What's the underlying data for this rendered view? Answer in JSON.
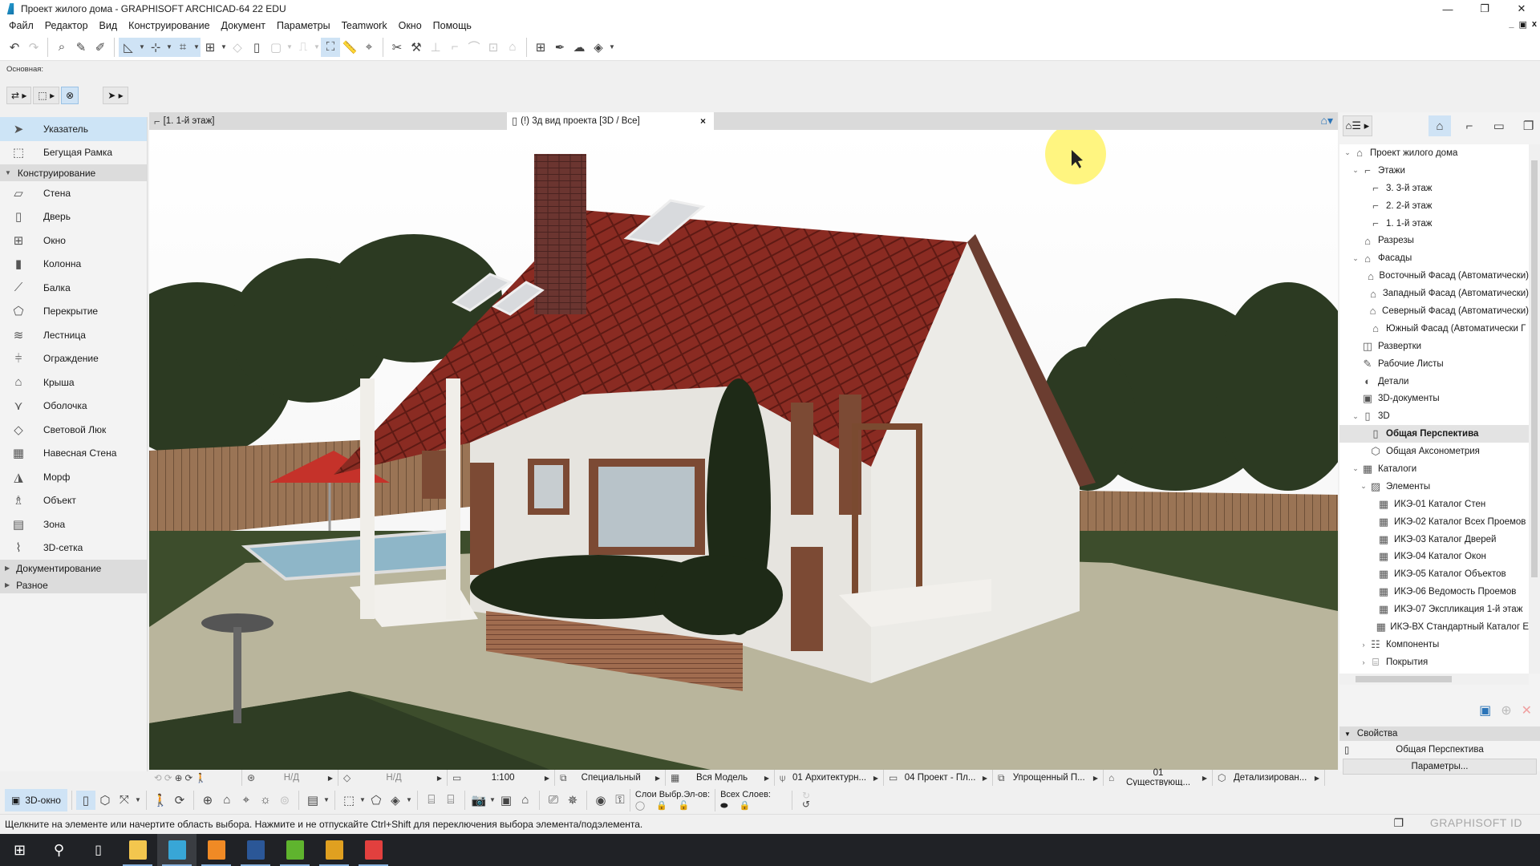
{
  "window": {
    "title": "Проект жилого дома - GRAPHISOFT ARCHICAD-64 22 EDU",
    "controls": [
      "—",
      "❐",
      "✕"
    ],
    "mdi_controls": [
      "_",
      "▣",
      "x"
    ]
  },
  "menu": [
    "Файл",
    "Редактор",
    "Вид",
    "Конструирование",
    "Документ",
    "Параметры",
    "Teamwork",
    "Окно",
    "Помощь"
  ],
  "infobox": {
    "label": "Основная:"
  },
  "toolbox": {
    "top_items": [
      {
        "label": "Указатель",
        "icon": "arrow-pointer-icon",
        "glyph": "➤",
        "selected": true
      },
      {
        "label": "Бегущая Рамка",
        "icon": "marquee-icon",
        "glyph": "⬚",
        "selected": false
      }
    ],
    "section_design": "Конструирование",
    "design_items": [
      {
        "label": "Стена",
        "icon": "wall-icon",
        "glyph": "▱"
      },
      {
        "label": "Дверь",
        "icon": "door-icon",
        "glyph": "▯"
      },
      {
        "label": "Окно",
        "icon": "window-icon",
        "glyph": "⊞"
      },
      {
        "label": "Колонна",
        "icon": "column-icon",
        "glyph": "▮"
      },
      {
        "label": "Балка",
        "icon": "beam-icon",
        "glyph": "⟋"
      },
      {
        "label": "Перекрытие",
        "icon": "slab-icon",
        "glyph": "⬠"
      },
      {
        "label": "Лестница",
        "icon": "stair-icon",
        "glyph": "≋"
      },
      {
        "label": "Ограждение",
        "icon": "railing-icon",
        "glyph": "⫩"
      },
      {
        "label": "Крыша",
        "icon": "roof-icon",
        "glyph": "⌂"
      },
      {
        "label": "Оболочка",
        "icon": "shell-icon",
        "glyph": "⋎"
      },
      {
        "label": "Световой Люк",
        "icon": "skylight-icon",
        "glyph": "◇"
      },
      {
        "label": "Навесная Стена",
        "icon": "curtain-wall-icon",
        "glyph": "▦"
      },
      {
        "label": "Морф",
        "icon": "morph-icon",
        "glyph": "◮"
      },
      {
        "label": "Объект",
        "icon": "object-icon",
        "glyph": "♗"
      },
      {
        "label": "Зона",
        "icon": "zone-icon",
        "glyph": "▤"
      },
      {
        "label": "3D-сетка",
        "icon": "mesh-icon",
        "glyph": "⌇"
      }
    ],
    "section_documentation": "Документирование",
    "section_misc": "Разное"
  },
  "view_tabs": [
    {
      "label": "[1. 1-й этаж]",
      "icon": "floor-plan-icon",
      "active": false
    },
    {
      "label": "(!) 3д вид проекта [3D / Все]",
      "icon": "3d-view-icon",
      "active": true,
      "close": "×"
    }
  ],
  "navigator": {
    "tree": [
      {
        "label": "Проект жилого дома",
        "level": 0,
        "caret": "⌄",
        "icon": "project-icon",
        "glyph": "⌂"
      },
      {
        "label": "Этажи",
        "level": 1,
        "caret": "⌄",
        "icon": "stories-icon",
        "glyph": "⌐"
      },
      {
        "label": "3. 3-й этаж",
        "level": 2,
        "caret": "",
        "icon": "story-icon",
        "glyph": "⌐"
      },
      {
        "label": "2. 2-й этаж",
        "level": 2,
        "caret": "",
        "icon": "story-icon",
        "glyph": "⌐"
      },
      {
        "label": "1. 1-й этаж",
        "level": 2,
        "caret": "",
        "icon": "story-icon",
        "glyph": "⌐"
      },
      {
        "label": "Разрезы",
        "level": 1,
        "caret": "",
        "icon": "section-icon",
        "glyph": "⌂"
      },
      {
        "label": "Фасады",
        "level": 1,
        "caret": "⌄",
        "icon": "elevation-icon",
        "glyph": "⌂"
      },
      {
        "label": "Восточный Фасад (Автоматически)",
        "level": 2,
        "caret": "",
        "icon": "elevation-icon",
        "glyph": "⌂"
      },
      {
        "label": "Западный Фасад (Автоматически)",
        "level": 2,
        "caret": "",
        "icon": "elevation-icon",
        "glyph": "⌂"
      },
      {
        "label": "Северный Фасад (Автоматически)",
        "level": 2,
        "caret": "",
        "icon": "elevation-icon",
        "glyph": "⌂"
      },
      {
        "label": "Южный Фасад (Автоматически Г",
        "level": 2,
        "caret": "",
        "icon": "elevation-icon",
        "glyph": "⌂"
      },
      {
        "label": "Развертки",
        "level": 1,
        "caret": "",
        "icon": "interior-elevation-icon",
        "glyph": "◫"
      },
      {
        "label": "Рабочие Листы",
        "level": 1,
        "caret": "",
        "icon": "worksheet-icon",
        "glyph": "✎"
      },
      {
        "label": "Детали",
        "level": 1,
        "caret": "",
        "icon": "detail-icon",
        "glyph": "◐"
      },
      {
        "label": "3D-документы",
        "level": 1,
        "caret": "",
        "icon": "3d-document-icon",
        "glyph": "▣"
      },
      {
        "label": "3D",
        "level": 1,
        "caret": "⌄",
        "icon": "3d-icon",
        "glyph": "▯"
      },
      {
        "label": "Общая Перспектива",
        "level": 2,
        "caret": "",
        "icon": "perspective-icon",
        "glyph": "▯",
        "selected": true
      },
      {
        "label": "Общая Аксонометрия",
        "level": 2,
        "caret": "",
        "icon": "axonometry-icon",
        "glyph": "⬡"
      },
      {
        "label": "Каталоги",
        "level": 1,
        "caret": "⌄",
        "icon": "schedule-icon",
        "glyph": "▦"
      },
      {
        "label": "Элементы",
        "level": 2,
        "caret": "⌄",
        "icon": "elements-icon",
        "glyph": "▨"
      },
      {
        "label": "ИКЭ-01 Каталог Стен",
        "level": 3,
        "caret": "",
        "icon": "table-icon",
        "glyph": "▦"
      },
      {
        "label": "ИКЭ-02 Каталог Всех Проемов",
        "level": 3,
        "caret": "",
        "icon": "table-icon",
        "glyph": "▦"
      },
      {
        "label": "ИКЭ-03 Каталог Дверей",
        "level": 3,
        "caret": "",
        "icon": "table-icon",
        "glyph": "▦"
      },
      {
        "label": "ИКЭ-04 Каталог Окон",
        "level": 3,
        "caret": "",
        "icon": "table-icon",
        "glyph": "▦"
      },
      {
        "label": "ИКЭ-05 Каталог Объектов",
        "level": 3,
        "caret": "",
        "icon": "table-icon",
        "glyph": "▦"
      },
      {
        "label": "ИКЭ-06 Ведомость Проемов",
        "level": 3,
        "caret": "",
        "icon": "table-icon",
        "glyph": "▦"
      },
      {
        "label": "ИКЭ-07 Экспликация 1-й этаж",
        "level": 3,
        "caret": "",
        "icon": "table-icon",
        "glyph": "▦"
      },
      {
        "label": "ИКЭ-ВХ Стандартный Каталог Е",
        "level": 3,
        "caret": "",
        "icon": "table-icon",
        "glyph": "▦"
      },
      {
        "label": "Компоненты",
        "level": 2,
        "caret": "›",
        "icon": "components-icon",
        "glyph": "☷"
      },
      {
        "label": "Покрытия",
        "level": 2,
        "caret": "›",
        "icon": "surfaces-icon",
        "glyph": "⌸"
      }
    ],
    "properties": {
      "header": "Свойства",
      "value": "Общая Перспектива",
      "button": "Параметры..."
    }
  },
  "quick_options": [
    {
      "label": "Н/Д",
      "icon": "zoom-fit-icon"
    },
    {
      "label": "Н/Д",
      "icon": "orientation-icon"
    },
    {
      "label": "1:100",
      "icon": "scale-icon"
    },
    {
      "label": "Специальный",
      "icon": "layer-combination-icon"
    },
    {
      "label": "Вся Модель",
      "icon": "model-view-icon"
    },
    {
      "label": "01 Архитектурн...",
      "icon": "pen-set-icon"
    },
    {
      "label": "04 Проект - Пл...",
      "icon": "dimension-icon"
    },
    {
      "label": "Упрощенный П...",
      "icon": "model-view-options-icon"
    },
    {
      "label": "01 Существующ...",
      "icon": "renovation-filter-icon"
    },
    {
      "label": "Детализирован...",
      "icon": "structural-display-icon"
    }
  ],
  "bottom_toolbar": {
    "window_3d_label": "3D-окно",
    "layers_selected_label": "Слои Выбр.Эл-ов:",
    "layers_all_label": "Всех Слоев:"
  },
  "status": {
    "hint": "Щелкните на элементе или начертите область выбора. Нажмите и не отпускайте Ctrl+Shift для переключения выбора элемента/подэлемента.",
    "brand": "GRAPHISOFT ID"
  },
  "taskbar": [
    {
      "name": "file-explorer",
      "color": "#f3c64e"
    },
    {
      "name": "archicad",
      "color": "#38a6d6",
      "active": true
    },
    {
      "name": "pdf-app",
      "color": "#f08a25"
    },
    {
      "name": "word",
      "color": "#2b5797"
    },
    {
      "name": "camtasia",
      "color": "#5fb42e"
    },
    {
      "name": "chrome",
      "color": "#e0a020"
    },
    {
      "name": "camtasia-recorder",
      "color": "#e2403e"
    }
  ]
}
